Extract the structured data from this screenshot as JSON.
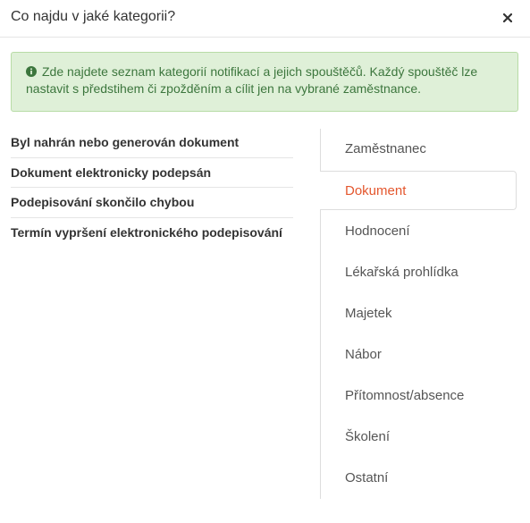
{
  "dialog": {
    "title": "Co najdu v jaké kategorii?"
  },
  "info": {
    "text": "Zde najdete seznam kategorií notifikací a jejich spouštěčů. Každý spouštěč lze nastavit s předstihem či zpožděním a cílit jen na vybrané zaměstnance."
  },
  "triggers": [
    "Byl nahrán nebo generován dokument",
    "Dokument elektronicky podepsán",
    "Podepisování skončilo chybou",
    "Termín vypršení elektronického podepisování"
  ],
  "categories": [
    "Zaměstnanec",
    "Dokument",
    "Hodnocení",
    "Lékařská prohlídka",
    "Majetek",
    "Nábor",
    "Přítomnost/absence",
    "Školení",
    "Ostatní"
  ],
  "active_category": "Dokument",
  "colors": {
    "accent": "#e4572e",
    "alert_bg": "#dff0d8",
    "alert_text": "#3c763d"
  }
}
